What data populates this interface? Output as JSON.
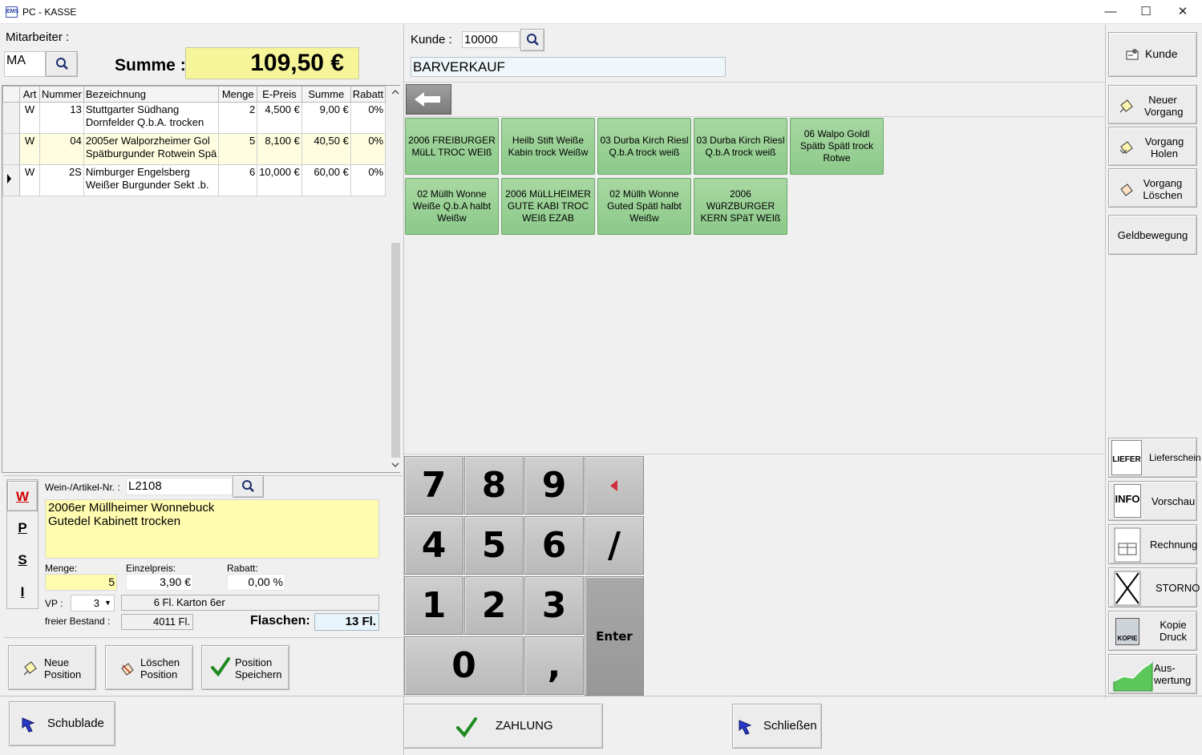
{
  "window": {
    "title": "PC - KASSE",
    "app_icon": "EMS",
    "minimize": "—",
    "maximize": "☐",
    "close": "✕"
  },
  "employee": {
    "label": "Mitarbeiter :",
    "value": "MA"
  },
  "total": {
    "label": "Summe :",
    "value": "109,50 €"
  },
  "customer": {
    "label": "Kunde :",
    "number": "10000",
    "name": "BARVERKAUF"
  },
  "grid": {
    "columns": [
      "Art",
      "Nummer",
      "Bezeichnung",
      "Menge",
      "E-Preis",
      "Summe",
      "Rabatt"
    ],
    "rows": [
      {
        "art": "W",
        "nummer": "13",
        "bez1": "Stuttgarter Südhang",
        "bez2": "Dornfelder Q.b.A. trocken",
        "menge": "2",
        "epreis": "4,500 €",
        "summe": "9,00 €",
        "rabatt": "0%"
      },
      {
        "art": "W",
        "nummer": "04",
        "bez1": "2005er Walporzheimer Gol",
        "bez2": "Spätburgunder Rotwein Spä",
        "menge": "5",
        "epreis": "8,100 €",
        "summe": "40,50 €",
        "rabatt": "0%"
      },
      {
        "art": "W",
        "nummer": "2S",
        "bez1": "Nimburger Engelsberg",
        "bez2": "Weißer Burgunder Sekt .b.",
        "menge": "6",
        "epreis": "10,000 €",
        "summe": "60,00 €",
        "rabatt": "0%"
      }
    ]
  },
  "article": {
    "types": [
      "W",
      "P",
      "S",
      "I"
    ],
    "number_label": "Wein-/Artikel-Nr. :",
    "number": "L2108",
    "description_line1": "2006er Müllheimer Wonnebuck",
    "description_line2": "Gutedel Kabinett trocken",
    "qty_label": "Menge:",
    "qty": "5",
    "price_label": "Einzelpreis:",
    "price": "3,90 €",
    "discount_label": "Rabatt:",
    "discount": "0,00 %",
    "vp_label": "VP :",
    "vp": "3",
    "vp_qty": "6 Fl.",
    "vp_name": "Karton 6er",
    "stock_label": "freier Bestand :",
    "stock": "4011 Fl.",
    "bottles_label": "Flaschen:",
    "bottles": "13 Fl."
  },
  "position_buttons": {
    "new_line1": "Neue",
    "new_line2": "Position",
    "delete_line1": "Löschen",
    "delete_line2": "Position",
    "save_line1": "Position",
    "save_line2": "Speichern"
  },
  "bottom": {
    "drawer": "Schublade",
    "payment": "ZAHLUNG",
    "close": "Schließen"
  },
  "tiles": [
    {
      "line1": "2006 FREIBURGER",
      "line2": "MüLL TROC WEIß",
      "line3": ""
    },
    {
      "line1": "Heilb Stift Weiße",
      "line2": "Kabin trock Weißw",
      "line3": ""
    },
    {
      "line1": "03 Durba Kirch Riesl",
      "line2": "Q.b.A trock weiß",
      "line3": ""
    },
    {
      "line1": "03 Durba Kirch Riesl",
      "line2": "Q.b.A trock weiß",
      "line3": ""
    },
    {
      "line1": "06 Walpo Goldl",
      "line2": "Spätb Spätl trock",
      "line3": "Rotwe"
    },
    {
      "line1": "02 Müllh Wonne",
      "line2": "Weiße Q.b.A halbt",
      "line3": "Weißw"
    },
    {
      "line1": "2006 MüLLHEIMER",
      "line2": "GUTE KABI TROC",
      "line3": "WEIß EZAB"
    },
    {
      "line1": "02 Müllh Wonne",
      "line2": "Guted Spätl halbt",
      "line3": "Weißw"
    },
    {
      "line1": "2006 WüRZBURGER",
      "line2": "KERN SPäT WEIß",
      "line3": ""
    }
  ],
  "keypad": {
    "k7": "7",
    "k8": "8",
    "k9": "9",
    "k4": "4",
    "k5": "5",
    "k6": "6",
    "slash": "/",
    "k1": "1",
    "k2": "2",
    "k3": "3",
    "k0": "0",
    "comma": ",",
    "enter": "Enter"
  },
  "sidebar": {
    "kunde": "Kunde",
    "new_process_1": "Neuer",
    "new_process_2": "Vorgang",
    "fetch_process_1": "Vorgang",
    "fetch_process_2": "Holen",
    "delete_process_1": "Vorgang",
    "delete_process_2": "Löschen",
    "cash_movement": "Geldbewegung",
    "delivery": "Lieferschein",
    "delivery_icon_text": "LIEFER",
    "preview": "Vorschau",
    "preview_icon_text": "INFO",
    "invoice": "Rechnung",
    "storno": "STORNO",
    "copy_1": "Kopie",
    "copy_2": "Druck",
    "copy_icon_text": "KOPIE",
    "eval_1": "Aus-",
    "eval_2": "wertung"
  }
}
